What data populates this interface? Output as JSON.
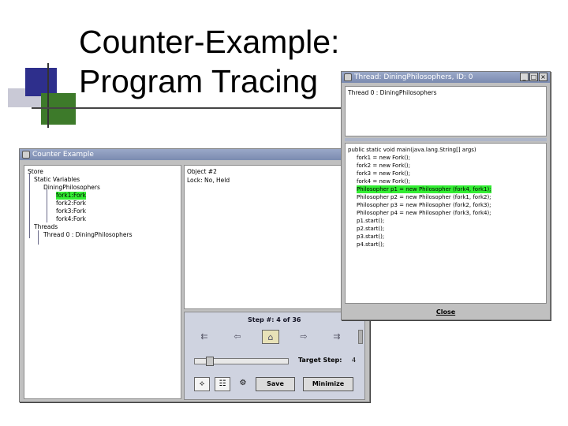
{
  "slide": {
    "title_line1": "Counter-Example:",
    "title_line2": "Program Tracing"
  },
  "counter_example_window": {
    "title": "Counter Example",
    "tree": [
      {
        "label": "Store",
        "depth": 0,
        "highlight": false
      },
      {
        "label": "Static Variables",
        "depth": 1,
        "highlight": false
      },
      {
        "label": "DiningPhilosophers",
        "depth": 2,
        "highlight": false
      },
      {
        "label": "fork1:Fork",
        "depth": 3,
        "highlight": true
      },
      {
        "label": "fork2:Fork",
        "depth": 3,
        "highlight": false
      },
      {
        "label": "fork3:Fork",
        "depth": 3,
        "highlight": false
      },
      {
        "label": "fork4:Fork",
        "depth": 3,
        "highlight": false
      },
      {
        "label": "Threads",
        "depth": 1,
        "highlight": false
      },
      {
        "label": "Thread 0 : DiningPhilosophers",
        "depth": 2,
        "highlight": false
      }
    ],
    "info": {
      "line1": "Object #2",
      "line2": "Lock: No, Held"
    },
    "controls": {
      "step_text": "Step #: 4 of 36",
      "target_label": "Target Step:",
      "target_value": "4",
      "save_label": "Save",
      "minimize_label": "Minimize"
    },
    "icons": [
      "first-icon",
      "back-icon",
      "home-icon",
      "forward-icon",
      "last-icon",
      "tree-toggle-icon",
      "list-icon",
      "settings-icon"
    ]
  },
  "thread_window": {
    "title": "Thread: DiningPhilosophers, ID: 0",
    "thread_label": "Thread 0 : DiningPhilosophers",
    "code": [
      {
        "text": "public static void main(java.lang.String[] args)",
        "highlight": false
      },
      {
        "text": "fork1 = new Fork();",
        "highlight": false
      },
      {
        "text": "fork2 = new Fork();",
        "highlight": false
      },
      {
        "text": "fork3 = new Fork();",
        "highlight": false
      },
      {
        "text": "fork4 = new Fork();",
        "highlight": false
      },
      {
        "text": "Philosopher p1 = new Philosopher (fork4, fork1);",
        "highlight": true
      },
      {
        "text": "Philosopher p2 = new Philosopher (fork1, fork2);",
        "highlight": false
      },
      {
        "text": "Philosopher p3 = new Philosopher (fork2, fork3);",
        "highlight": false
      },
      {
        "text": "Philosopher p4 = new Philosopher (fork3, fork4);",
        "highlight": false
      },
      {
        "text": "p1.start();",
        "highlight": false
      },
      {
        "text": "p2.start();",
        "highlight": false
      },
      {
        "text": "p3.start();",
        "highlight": false
      },
      {
        "text": "p4.start();",
        "highlight": false
      }
    ],
    "close_label": "Close",
    "window_buttons": [
      "_",
      "□",
      "×"
    ]
  },
  "colors": {
    "highlight": "#33ee33",
    "titlebar": "#7b8bb0",
    "panel_bg": "#c0c0c0"
  }
}
